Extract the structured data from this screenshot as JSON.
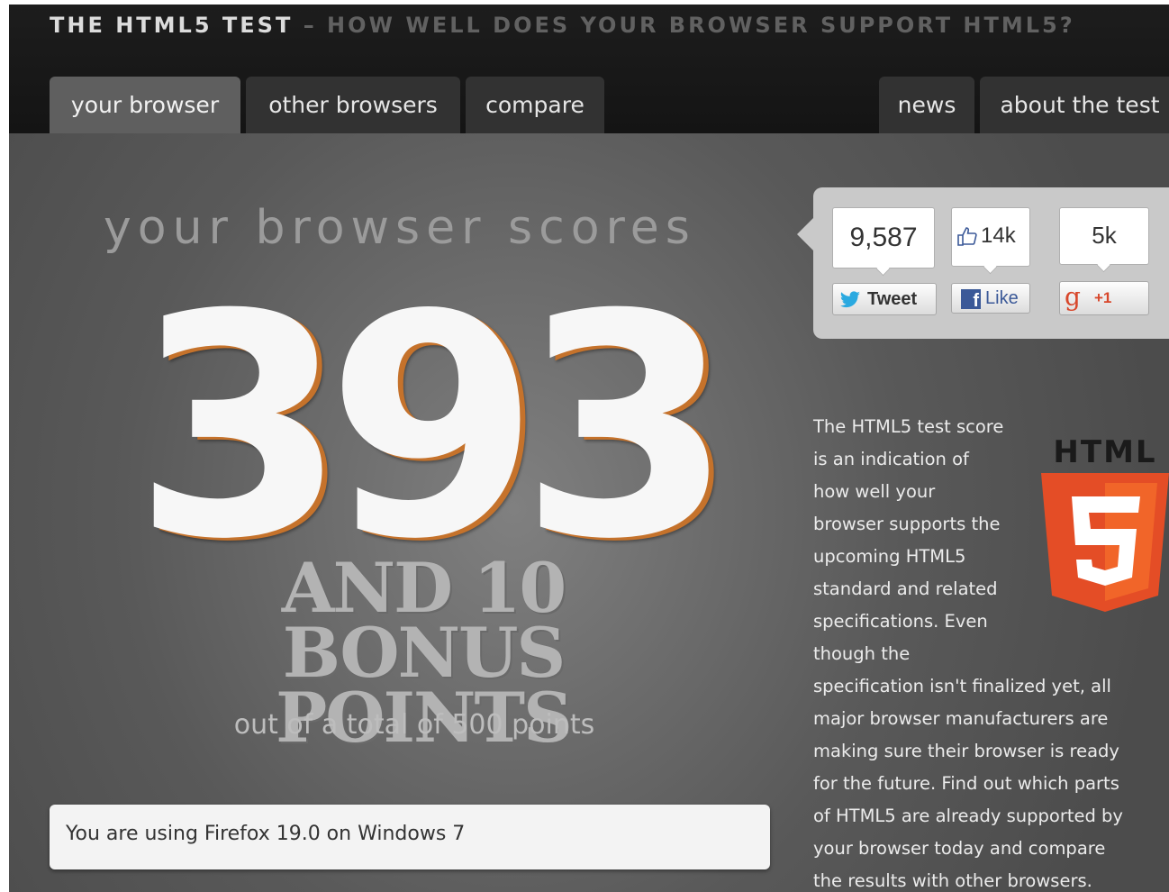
{
  "header": {
    "title_main": "THE HTML5 TEST",
    "title_sub": "– HOW WELL DOES YOUR BROWSER SUPPORT HTML5?"
  },
  "nav": {
    "left_tabs": [
      "your browser",
      "other browsers",
      "compare"
    ],
    "right_tabs": [
      "news",
      "about the test"
    ],
    "active_tab": "your browser"
  },
  "score": {
    "heading": "your browser scores",
    "value": "393",
    "bonus_line1": "AND 10 BONUS",
    "bonus_line2": "POINTS",
    "total": "out of a total of 500 points"
  },
  "browser_info": "You are using Firefox 19.0 on Windows 7",
  "social": {
    "twitter_count": "9,587",
    "twitter_label": "Tweet",
    "facebook_count": "14k",
    "facebook_label": "Like",
    "gplus_count": "5k",
    "gplus_label": "+1"
  },
  "description": [
    "The HTML5 test score",
    "is an indication of",
    "how well your",
    "browser supports the",
    "upcoming HTML5",
    "standard and related",
    "specifications. Even",
    "though the",
    "specification isn't finalized yet, all",
    "major browser manufacturers are",
    "making sure their browser is ready",
    "for the future. Find out which parts",
    "of HTML5 are already supported by",
    "your browser today and compare",
    "the results with other browsers."
  ],
  "logo": {
    "wordmark": "HTML",
    "numeral": "5"
  },
  "colors": {
    "score_shadow": "#c5722b",
    "html5_orange": "#e44d26",
    "html5_orange_light": "#f16529",
    "twitter_blue": "#2aa9e0",
    "facebook_blue": "#3b5998",
    "gplus_red": "#d8472b"
  }
}
